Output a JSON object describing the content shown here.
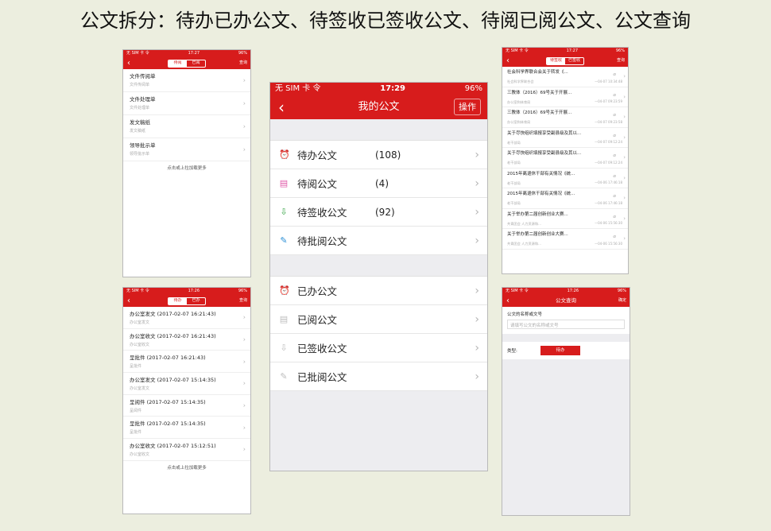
{
  "heading": "公文拆分：待办已办公文、待签收已签收公文、待阅已阅公文、公文查询",
  "colors": {
    "brand_red": "#d71c1c",
    "background": "#eceedf"
  },
  "status_small": {
    "carrier": "无 SIM 卡 令",
    "battery": "96%"
  },
  "phone_a": {
    "time": "17:27",
    "tab_on": "待阅",
    "tab_off": "已阅",
    "action": "查询",
    "items": [
      {
        "title": "文件传阅单",
        "sub": "文件传阅单"
      },
      {
        "title": "文件处理单",
        "sub": "文件处理单"
      },
      {
        "title": "发文稿纸",
        "sub": "发文稿纸"
      },
      {
        "title": "领导批示单",
        "sub": "领导批示单"
      }
    ],
    "more": "点击或上拉加载更多"
  },
  "phone_b": {
    "time": "17:26",
    "tab_on": "待办",
    "tab_off": "已办",
    "action": "查询",
    "items": [
      {
        "title": "办公室发文 (2017-02-07 16:21:43)",
        "sub": "办公室发文"
      },
      {
        "title": "办公室收文 (2017-02-07 16:21:43)",
        "sub": "办公室收文"
      },
      {
        "title": "呈批件 (2017-02-07 16:21:43)",
        "sub": "呈批件"
      },
      {
        "title": "办公室发文 (2017-02-07 15:14:35)",
        "sub": "办公室发文"
      },
      {
        "title": "呈阅件 (2017-02-07 15:14:35)",
        "sub": "呈阅件"
      },
      {
        "title": "呈批件 (2017-02-07 15:14:35)",
        "sub": "呈批件"
      },
      {
        "title": "办公室收文 (2017-02-07 15:12:51)",
        "sub": "办公室收文"
      }
    ],
    "more": "点击或上拉加载更多"
  },
  "main_phone": {
    "carrier": "无 SIM 卡 令",
    "time": "17:29",
    "battery": "96%",
    "title": "我的公文",
    "back": "‹",
    "action": "操作",
    "group1": [
      {
        "label": "待办公文",
        "count": "(108)",
        "icon": "alarm-clock-icon",
        "glyph": "⏰",
        "color": "#f0922a"
      },
      {
        "label": "待阅公文",
        "count": "(4)",
        "icon": "read-doc-icon",
        "glyph": "▤",
        "color": "#e05aa8"
      },
      {
        "label": "待签收公文",
        "count": "(92)",
        "icon": "sign-inbox-icon",
        "glyph": "⇩",
        "color": "#3aa548"
      },
      {
        "label": "待批阅公文",
        "count": "",
        "icon": "approve-edit-icon",
        "glyph": "✎",
        "color": "#2c8fd6"
      }
    ],
    "group2": [
      {
        "label": "已办公文",
        "icon": "alarm-clock-icon",
        "glyph": "⏰"
      },
      {
        "label": "已阅公文",
        "icon": "read-doc-icon",
        "glyph": "▤"
      },
      {
        "label": "已签收公文",
        "icon": "sign-inbox-icon",
        "glyph": "⇩"
      },
      {
        "label": "已批阅公文",
        "icon": "approve-edit-icon",
        "glyph": "✎"
      }
    ]
  },
  "phone_c": {
    "time": "17:27",
    "tab_on": "待签收",
    "tab_off": "已签收",
    "action": "查询",
    "items": [
      {
        "title": "社会科学界联合会关于转发《...",
        "sub": "社会科学界联合会",
        "time": "—04-07 10:34:48"
      },
      {
        "title": "三教体（2016）69号关于开展...",
        "sub": "办公室和体育局",
        "time": "—04-07 09:23:59"
      },
      {
        "title": "三教体（2016）69号关于开展...",
        "sub": "办公室和体育局",
        "time": "—04-07 09:23:58"
      },
      {
        "title": "关于尽快组织填报享受副县级及其以...",
        "sub": "老干部局",
        "time": "—04-07 09:12:24"
      },
      {
        "title": "关于尽快组织填报享受副县级及其以...",
        "sub": "老干部局",
        "time": "—04-07 09:12:24"
      },
      {
        "title": "2015年离退休干部有关情况《统...",
        "sub": "老干部局",
        "time": "—04-06 17:46:18"
      },
      {
        "title": "2015年离退休干部有关情况《统...",
        "sub": "老干部局",
        "time": "—04-06 17:46:18"
      },
      {
        "title": "关于举办第二届创新创业大赛...",
        "sub": "共青团会 人力资源和...",
        "time": "—04-06 15:56:30"
      },
      {
        "title": "关于举办第二届创新创业大赛...",
        "sub": "共青团会 人力资源和...",
        "time": "—04-06 15:56:30"
      }
    ]
  },
  "phone_d": {
    "time": "17:26",
    "title": "公文查询",
    "action": "确定",
    "field_label": "公文的名称或文号",
    "field_placeholder": "请填写公文的名称或文号",
    "type_label": "类型:",
    "type_value": "待办"
  }
}
